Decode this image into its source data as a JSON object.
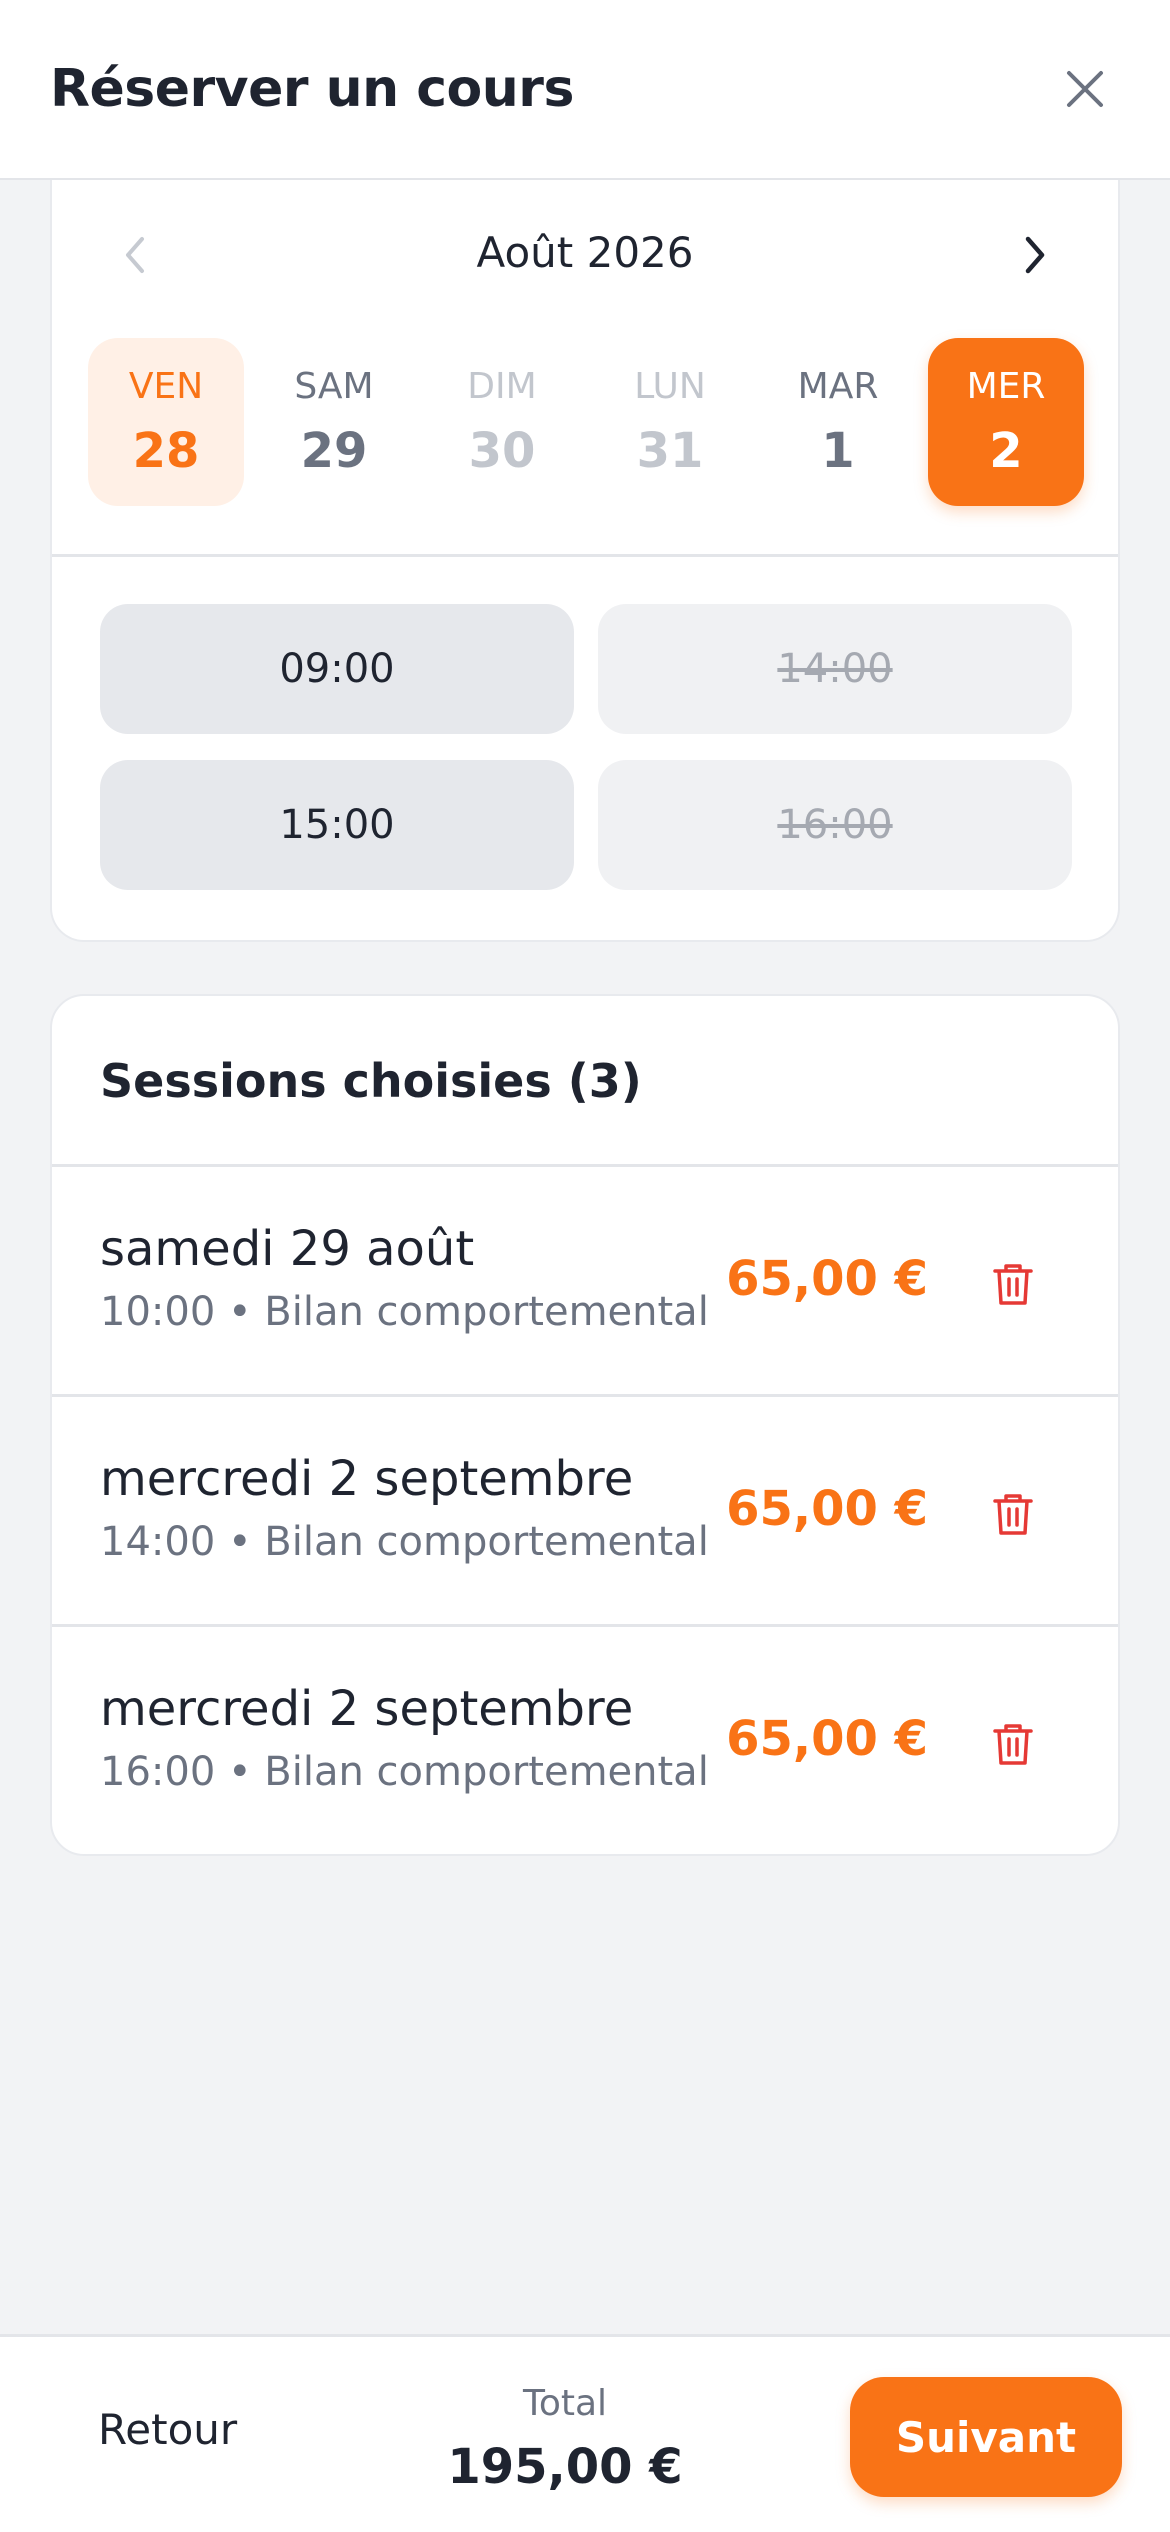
{
  "header": {
    "title": "Réserver un cours",
    "close_icon": "close-icon"
  },
  "calendar": {
    "month": "Août 2026",
    "prev_icon": "chevron-left-icon",
    "next_icon": "chevron-right-icon",
    "days": [
      {
        "dow": "VEN",
        "num": "28",
        "state": "today"
      },
      {
        "dow": "SAM",
        "num": "29",
        "state": "available"
      },
      {
        "dow": "DIM",
        "num": "30",
        "state": "unavailable"
      },
      {
        "dow": "LUN",
        "num": "31",
        "state": "unavailable"
      },
      {
        "dow": "MAR",
        "num": "1",
        "state": "available"
      },
      {
        "dow": "MER",
        "num": "2",
        "state": "selected"
      }
    ],
    "slots": [
      {
        "time": "09:00",
        "state": "available"
      },
      {
        "time": "14:00",
        "state": "booked"
      },
      {
        "time": "15:00",
        "state": "available"
      },
      {
        "time": "16:00",
        "state": "booked"
      }
    ]
  },
  "sessions": {
    "title": "Sessions choisies (3)",
    "items": [
      {
        "date": "samedi 29 août",
        "detail": "10:00 • Bilan comportemental",
        "price": "65,00 €",
        "delete_icon": "trash-icon"
      },
      {
        "date": "mercredi 2 septembre",
        "detail": "14:00 • Bilan comportemental",
        "price": "65,00 €",
        "delete_icon": "trash-icon"
      },
      {
        "date": "mercredi 2 septembre",
        "detail": "16:00 • Bilan comportemental",
        "price": "65,00 €",
        "delete_icon": "trash-icon"
      }
    ]
  },
  "footer": {
    "back_label": "Retour",
    "total_label": "Total",
    "total_value": "195,00 €",
    "next_label": "Suivant"
  },
  "colors": {
    "accent": "#f97316",
    "accent_light": "#fff0e6",
    "danger": "#e53935",
    "text": "#1f2430",
    "muted": "#6b7280",
    "background": "#f2f3f5"
  }
}
